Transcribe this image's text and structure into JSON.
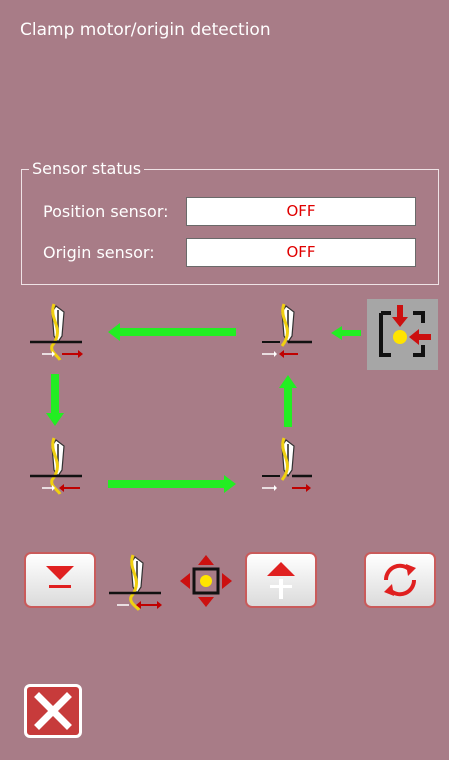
{
  "window": {
    "title": "Clamp motor/origin detection"
  },
  "sensor_status": {
    "legend": "Sensor status",
    "position_label": "Position sensor:",
    "position_value": "OFF",
    "origin_label": "Origin sensor:",
    "origin_value": "OFF"
  },
  "diagram": {
    "states": [
      "clamp-state-top-left",
      "clamp-state-top-right",
      "clamp-state-bottom-left",
      "clamp-state-bottom-right"
    ],
    "arrow_color": "#22ee22"
  },
  "controls": {
    "icons": [
      "move-down-button",
      "clamp-state-icon",
      "move-cross-icon",
      "move-up-button",
      "cycle-button",
      "close-button"
    ]
  },
  "colors": {
    "background": "#a87c87",
    "value_text": "#e00000",
    "accent_red": "#cc1010",
    "arrow_green": "#22ee22",
    "needle_yellow": "#f0d010"
  }
}
